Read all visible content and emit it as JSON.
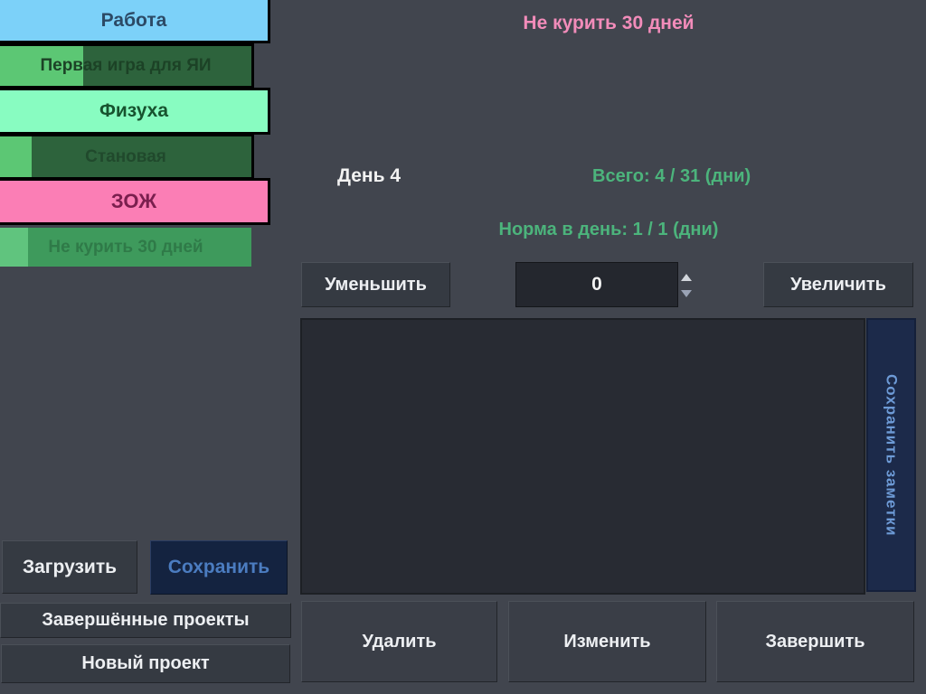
{
  "window": {
    "background": "#41454e"
  },
  "sidebar": {
    "items": [
      {
        "label": "Работа",
        "type": "project",
        "bg": "#7cd1f9",
        "text_color": "#2c4a66",
        "progress": null
      },
      {
        "label": "Первая игра для ЯИ",
        "type": "subtask",
        "bg": "#2d633c",
        "strip_color": "#5cc774",
        "text_color": "#1c4226",
        "progress": 0.33
      },
      {
        "label": "Физуха",
        "type": "project",
        "bg": "#88fcc1",
        "text_color": "#17532f",
        "progress": null
      },
      {
        "label": "Становая",
        "type": "subtask",
        "bg": "#2d633c",
        "strip_color": "#5cc774",
        "text_color": "#20492c",
        "progress": 0.125
      },
      {
        "label": "ЗОЖ",
        "type": "project",
        "bg": "#fb7eb5",
        "text_color": "#7a1f4e",
        "progress": null
      },
      {
        "label": "Не курить 30 дней",
        "type": "subtask-selected",
        "bg": "#3e9a5c",
        "strip_color": "#60c47e",
        "text_color": "#2f7a48",
        "progress": 0.11
      }
    ],
    "load_label": "Загрузить",
    "save_label": "Сохранить",
    "completed_projects_label": "Завершённые проекты",
    "new_project_label": "Новый проект"
  },
  "main": {
    "title": "Не курить 30 дней",
    "title_color": "#f28cba",
    "day_label": "День 4",
    "total_label": "Всего: 4 / 31 (дни)",
    "norm_label": "Норма в день: 1 / 1 (дни)",
    "stats_color": "#4cb47c",
    "decrease_label": "Уменьшить",
    "spin_value": "0",
    "increase_label": "Увеличить",
    "notes_value": "",
    "save_notes_label": "Сохранить заметки",
    "delete_label": "Удалить",
    "edit_label": "Изменить",
    "complete_label": "Завершить"
  },
  "colors": {
    "background": "#41454e",
    "dark_button": "#353a42",
    "navy_button": "#142340",
    "navy_button_text": "#4b7cc0",
    "save_notes_bg": "#1c2a4a",
    "save_notes_text": "#6d9ad6",
    "spinbox_bg": "#24272e",
    "border_black": "#000000"
  }
}
